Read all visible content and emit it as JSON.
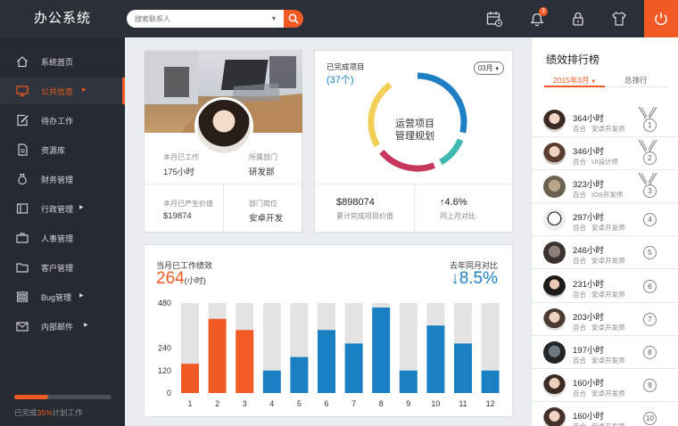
{
  "app": {
    "title": "办公系统",
    "search_placeholder": "搜索联系人",
    "notification_count": "3"
  },
  "sidebar": {
    "items": [
      {
        "label": "系统首页",
        "arrow": false,
        "active": false
      },
      {
        "label": "公共信息",
        "arrow": true,
        "active": true
      },
      {
        "label": "待办工作",
        "arrow": false,
        "active": false
      },
      {
        "label": "资源库",
        "arrow": false,
        "active": false
      },
      {
        "label": "财务管理",
        "arrow": false,
        "active": false
      },
      {
        "label": "行政管理",
        "arrow": true,
        "active": false
      },
      {
        "label": "人事管理",
        "arrow": false,
        "active": false
      },
      {
        "label": "客户管理",
        "arrow": false,
        "active": false
      },
      {
        "label": "Bug管理",
        "arrow": true,
        "active": false
      },
      {
        "label": "内部邮件",
        "arrow": true,
        "active": false
      }
    ],
    "progress": {
      "fraction": 0.35,
      "prefix": "已完成",
      "percent": "35%",
      "suffix": "计划工作"
    }
  },
  "profile": {
    "work_label": "本月已工作",
    "work_value": "175小时",
    "dept_label": "所属部门",
    "dept_value": "研发部",
    "value_label": "本月已产生价值",
    "value_value": "$19874",
    "post_label": "部门岗位",
    "post_value": "安卓开发"
  },
  "projects": {
    "title": "已完成项目",
    "count": "(37个)",
    "month": "03月",
    "center_line1": "运营项目",
    "center_line2": "管理规划",
    "total_value": "$898074",
    "total_label": "累计完成项目价值",
    "growth_value": "↑4.6%",
    "growth_label": "同上月对比"
  },
  "chart_header": {
    "title": "当月已工作绩效",
    "value": "264",
    "unit": "(小时)",
    "yoy_label": "去年同月对比",
    "yoy_value": "↓8.5%"
  },
  "chart_data": {
    "type": "bar",
    "categories": [
      "1",
      "2",
      "3",
      "4",
      "5",
      "6",
      "7",
      "8",
      "9",
      "10",
      "11",
      "12"
    ],
    "values": [
      130,
      330,
      280,
      100,
      160,
      280,
      220,
      380,
      100,
      300,
      220,
      100
    ],
    "max": 400,
    "ylim": [
      0,
      480
    ],
    "yticks": [
      "480",
      "240",
      "120",
      "0"
    ],
    "ytick_values": [
      400,
      200,
      100,
      0
    ],
    "highlight": [
      true,
      true,
      true,
      false,
      false,
      false,
      false,
      false,
      false,
      false,
      false,
      false
    ],
    "colors": {
      "highlight": "#f15a24",
      "normal": "#1a80c4",
      "track": "#e3e3e3"
    }
  },
  "ranking": {
    "title": "绩效排行榜",
    "tab_month": "2015年3月",
    "tab_total": "总排行",
    "rows": [
      {
        "hours": "364小时",
        "company": "百合",
        "role": "安卓开发师",
        "rank": "1"
      },
      {
        "hours": "346小时",
        "company": "百合",
        "role": "UI设计师",
        "rank": "2"
      },
      {
        "hours": "323小时",
        "company": "百合",
        "role": "IOS开发师",
        "rank": "3"
      },
      {
        "hours": "297小时",
        "company": "百合",
        "role": "安卓开发师",
        "rank": "4"
      },
      {
        "hours": "246小时",
        "company": "百合",
        "role": "安卓开发师",
        "rank": "5"
      },
      {
        "hours": "231小时",
        "company": "百合",
        "role": "安卓开发师",
        "rank": "6"
      },
      {
        "hours": "203小时",
        "company": "百合",
        "role": "安卓开发师",
        "rank": "7"
      },
      {
        "hours": "197小时",
        "company": "百合",
        "role": "安卓开发师",
        "rank": "8"
      },
      {
        "hours": "160小时",
        "company": "百合",
        "role": "安卓开发师",
        "rank": "9"
      },
      {
        "hours": "160小时",
        "company": "百合",
        "role": "安卓开发师",
        "rank": "10"
      }
    ]
  },
  "colors": {
    "accent": "#f15a24",
    "blue": "#1e7fc4",
    "header_bg": "#2b3038",
    "sidebar_bg": "#262a31"
  }
}
